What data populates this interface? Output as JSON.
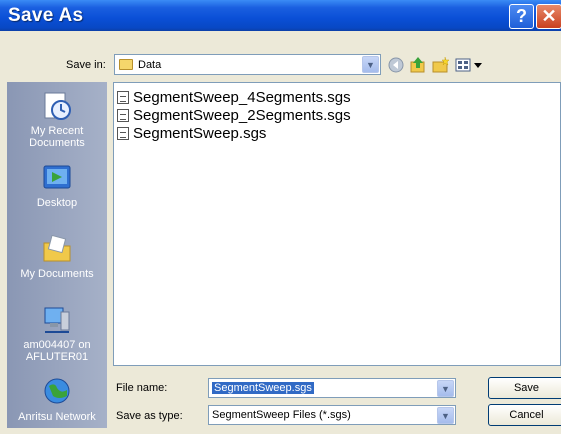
{
  "window": {
    "title": "Save As"
  },
  "title_buttons": {
    "help": "?",
    "close": "✕"
  },
  "save_in": {
    "label": "Save in:",
    "value": "Data"
  },
  "places": [
    {
      "label": "My Recent Documents",
      "icon": "recent-documents-icon"
    },
    {
      "label": "Desktop",
      "icon": "desktop-icon"
    },
    {
      "label": "My Documents",
      "icon": "my-documents-icon"
    },
    {
      "label": "am004407 on AFLUTER01",
      "icon": "network-computer-icon"
    },
    {
      "label": "Anritsu Network",
      "icon": "network-globe-icon"
    }
  ],
  "files": [
    "SegmentSweep_4Segments.sgs",
    "SegmentSweep_2Segments.sgs",
    "SegmentSweep.sgs"
  ],
  "file_name": {
    "label": "File name:",
    "value": "SegmentSweep.sgs"
  },
  "save_as_type": {
    "label": "Save as type:",
    "value": "SegmentSweep Files (*.sgs)"
  },
  "buttons": {
    "save": "Save",
    "cancel": "Cancel"
  },
  "colors": {
    "titlebar": "#0a4fd6",
    "places_bar": "#9da9c2",
    "selection": "#316ac5"
  }
}
